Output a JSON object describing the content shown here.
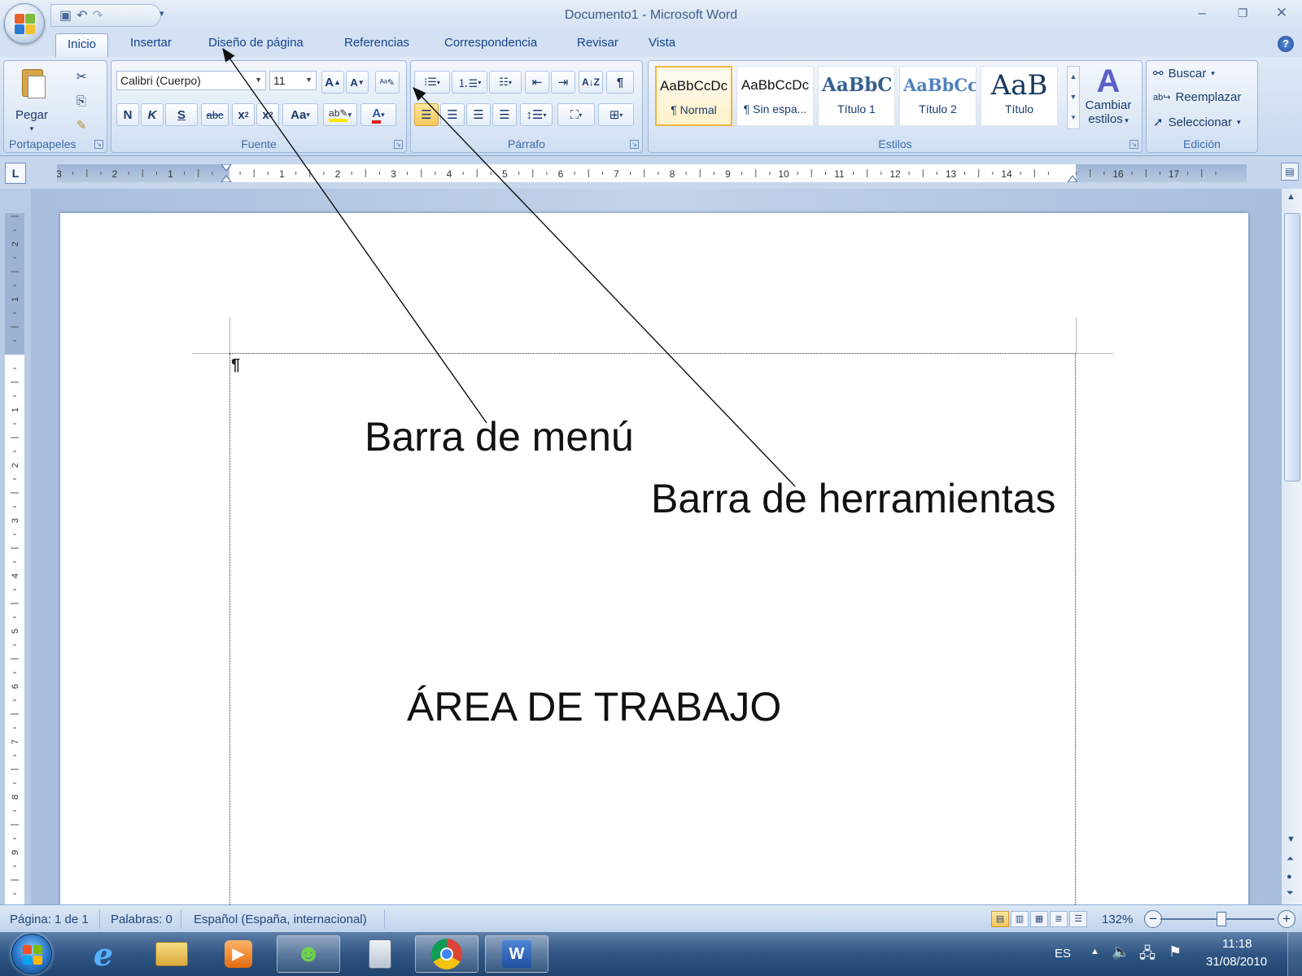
{
  "window": {
    "title": "Documento1 - Microsoft Word",
    "controls": {
      "minimize": "–",
      "restore": "❐",
      "close": "✕"
    }
  },
  "quick_access": {
    "icons": [
      "save-icon",
      "undo-icon",
      "redo-icon",
      "customize-icon"
    ]
  },
  "tabs": [
    "Inicio",
    "Insertar",
    "Diseño de página",
    "Referencias",
    "Correspondencia",
    "Revisar",
    "Vista"
  ],
  "active_tab": "Inicio",
  "ribbon": {
    "clipboard": {
      "paste_label": "Pegar",
      "group_label": "Portapapeles"
    },
    "font": {
      "font_name": "Calibri (Cuerpo)",
      "font_size": "11",
      "group_label": "Fuente",
      "bold": "N",
      "italic": "K",
      "underline": "S",
      "strike": "abc",
      "change_case": "Aa"
    },
    "paragraph": {
      "group_label": "Párrafo",
      "pilcrow": "¶"
    },
    "styles": {
      "group_label": "Estilos",
      "items": [
        {
          "sample": "AaBbCcDc",
          "name": "¶ Normal"
        },
        {
          "sample": "AaBbCcDc",
          "name": "¶ Sin espa..."
        },
        {
          "sample": "AaBbC(",
          "name": "Título 1"
        },
        {
          "sample": "AaBbCc",
          "name": "Título 2"
        },
        {
          "sample": "AaB",
          "name": "Título"
        }
      ],
      "change_styles_line1": "Cambiar",
      "change_styles_line2": "estilos"
    },
    "editing": {
      "group_label": "Edición",
      "find": "Buscar",
      "replace": "Reemplazar",
      "select": "Seleccionar"
    }
  },
  "ruler": {
    "corner_symbol": "L",
    "horizontal_labels": [
      "3",
      "2",
      "1",
      "1",
      "2",
      "3",
      "4",
      "5",
      "6",
      "7",
      "8",
      "9",
      "10",
      "11",
      "12",
      "13",
      "14",
      "16",
      "17"
    ],
    "vertical_labels": [
      "2",
      "1",
      "1",
      "2",
      "3",
      "4",
      "5",
      "6",
      "7",
      "8",
      "9"
    ]
  },
  "document": {
    "paragraph_mark": "¶",
    "annotation_menu": "Barra de menú",
    "annotation_toolbar": "Barra de herramientas",
    "work_area": "ÁREA DE TRABAJO"
  },
  "status": {
    "page": "Página: 1 de 1",
    "words": "Palabras: 0",
    "language": "Español (España, internacional)",
    "zoom": "132%"
  },
  "taskbar": {
    "language": "ES",
    "time": "11:18",
    "date": "31/08/2010"
  },
  "colors": {
    "ribbon_text": "#15428b",
    "selected_style": "#f0b543",
    "taskbar": "#2f5583"
  }
}
